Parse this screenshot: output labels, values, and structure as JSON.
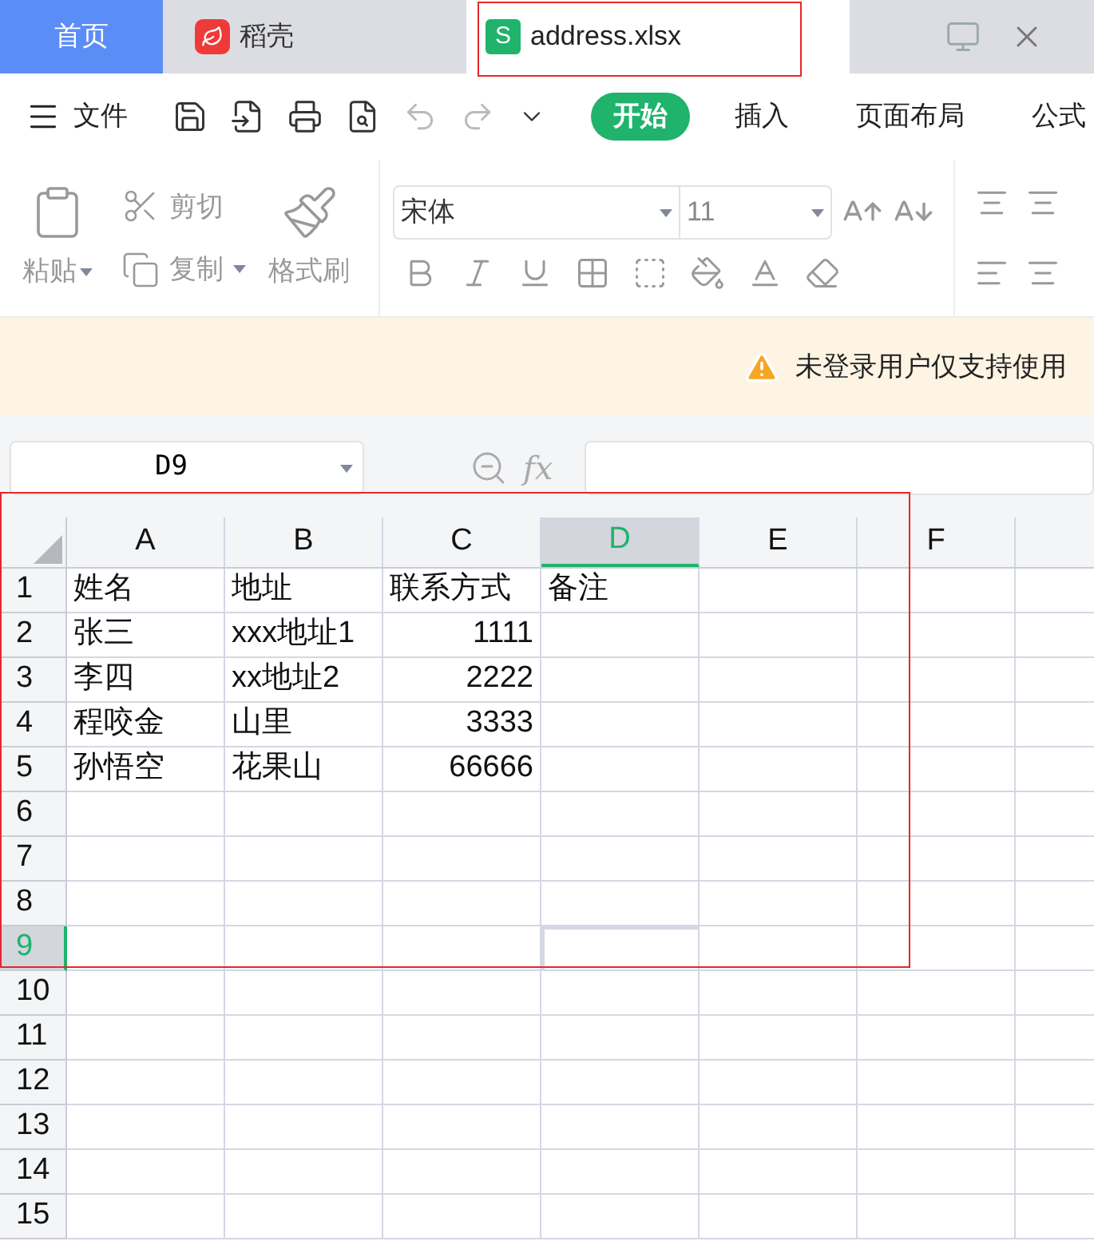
{
  "tabs": [
    {
      "label": "首页",
      "kind": "home",
      "selected": false
    },
    {
      "label": "稻壳",
      "kind": "docer",
      "selected": false
    },
    {
      "label": "address.xlsx",
      "kind": "sheet",
      "badge": "S",
      "selected": true
    }
  ],
  "menu": {
    "file": "文件",
    "tabs": [
      {
        "label": "开始",
        "selected": true
      },
      {
        "label": "插入",
        "selected": false
      },
      {
        "label": "页面布局",
        "selected": false
      },
      {
        "label": "公式",
        "selected": false
      }
    ]
  },
  "ribbon": {
    "paste": "粘贴",
    "cut": "剪切",
    "copy": "复制",
    "format_painter": "格式刷",
    "font": "宋体",
    "size": "11"
  },
  "notice": "未登录用户仅支持使用",
  "formula_bar": {
    "name_box": "D9",
    "fx": "fx"
  },
  "columns": [
    {
      "label": "A",
      "selected": false
    },
    {
      "label": "B",
      "selected": false
    },
    {
      "label": "C",
      "selected": false
    },
    {
      "label": "D",
      "selected": true
    },
    {
      "label": "E",
      "selected": false
    },
    {
      "label": "F",
      "selected": false
    },
    {
      "selected": false
    }
  ],
  "rows": [
    {
      "label": "1",
      "selected": false,
      "cells": [
        {
          "text": "姓名",
          "kind": "text"
        },
        {
          "text": "地址",
          "kind": "text"
        },
        {
          "text": "联系方式",
          "kind": "text"
        },
        {
          "text": "备注",
          "kind": "text"
        }
      ]
    },
    {
      "label": "2",
      "selected": false,
      "cells": [
        {
          "text": "张三",
          "kind": "text"
        },
        {
          "text": "xxx地址1",
          "kind": "text"
        },
        {
          "text": "1111",
          "kind": "number"
        }
      ]
    },
    {
      "label": "3",
      "selected": false,
      "cells": [
        {
          "text": "李四",
          "kind": "text"
        },
        {
          "text": "xx地址2",
          "kind": "text"
        },
        {
          "text": "2222",
          "kind": "number"
        }
      ]
    },
    {
      "label": "4",
      "selected": false,
      "cells": [
        {
          "text": "程咬金",
          "kind": "text"
        },
        {
          "text": "山里",
          "kind": "text"
        },
        {
          "text": "3333",
          "kind": "number"
        }
      ]
    },
    {
      "label": "5",
      "selected": false,
      "cells": [
        {
          "text": "孙悟空",
          "kind": "text"
        },
        {
          "text": "花果山",
          "kind": "text"
        },
        {
          "text": "66666",
          "kind": "number"
        }
      ]
    },
    {
      "label": "6",
      "selected": false
    },
    {
      "label": "7",
      "selected": false
    },
    {
      "label": "8",
      "selected": false
    },
    {
      "label": "9",
      "selected": true
    },
    {
      "label": "10",
      "selected": false
    },
    {
      "label": "11",
      "selected": false
    },
    {
      "label": "12",
      "selected": false
    },
    {
      "label": "13",
      "selected": false
    },
    {
      "label": "14",
      "selected": false
    },
    {
      "label": "15",
      "selected": false
    }
  ]
}
